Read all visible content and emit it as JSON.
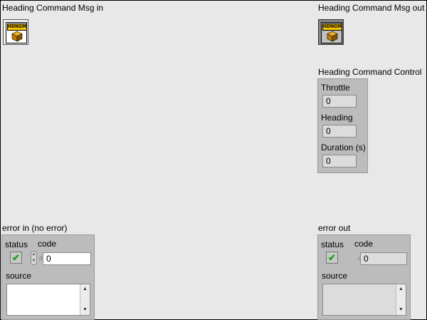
{
  "msg_in": {
    "label": "Heading Command Msg in",
    "tag": "HDNGM"
  },
  "msg_out": {
    "label": "Heading Command Msg out",
    "tag": "HDNGM"
  },
  "control": {
    "label": "Heading Command Control",
    "throttle_label": "Throttle",
    "throttle_value": "0",
    "heading_label": "Heading",
    "heading_value": "0",
    "duration_label": "Duration (s)",
    "duration_value": "0"
  },
  "error_in": {
    "label": "error in (no error)",
    "status_label": "status",
    "code_label": "code",
    "code_value": "0",
    "source_label": "source",
    "radix": "d"
  },
  "error_out": {
    "label": "error out",
    "status_label": "status",
    "code_label": "code",
    "code_value": "0",
    "source_label": "source",
    "radix": "d"
  },
  "colors": {
    "accent_tag": "#f5c400",
    "check": "#1aa01a",
    "cluster": "#bcbcbc"
  }
}
